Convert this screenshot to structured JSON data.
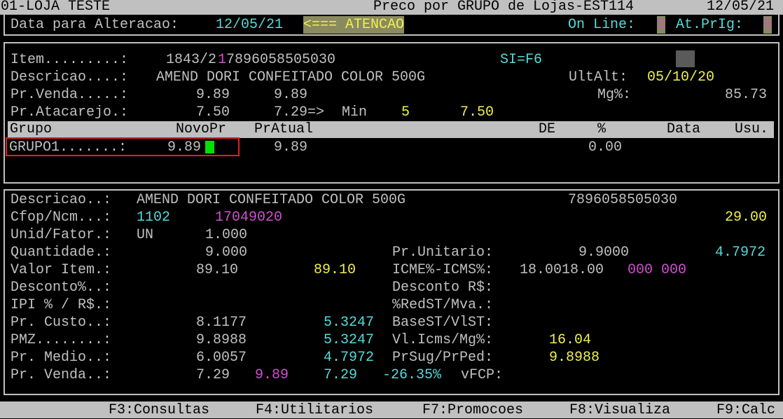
{
  "header": {
    "store": "01-LOJA TESTE",
    "title": "Preco por GRUPO de Lojas-EST114",
    "date": "12/05/21"
  },
  "status": {
    "date_label": "Data para Alteracao:",
    "date_value": "12/05/21",
    "attention": "<=== ATENCAO",
    "online_label": "On Line:",
    "online_value": "S",
    "atprig_label": "At.PrIg:",
    "atprig_value": "S"
  },
  "item": {
    "item_label": "Item.........:",
    "item_code_a": "1843/2",
    "item_code_b": "1",
    "ean": "7896058505030",
    "si": "SI=F6",
    "desc_label": "Descricao....:",
    "desc": "AMEND DORI CONFEITADO COLOR 500G",
    "ultalt_label": "UltAlt:",
    "ultalt": "05/10/20",
    "prvenda_label": "Pr.Venda.....:",
    "prvenda1": "9.89",
    "prvenda2": "9.89",
    "mg_label": "Mg%:",
    "mg": "85.73",
    "atac_label": "Pr.Atacarejo.:",
    "atac1": "7.50",
    "atac2": "7.29=>",
    "min_label": "Min",
    "min_qty": "5",
    "min_price": "7.50"
  },
  "grid": {
    "headers": {
      "grupo": "Grupo",
      "novopr": "NovoPr",
      "pratual": "PrAtual",
      "de": "DE",
      "pct": "%",
      "data": "Data",
      "usu": "Usu."
    },
    "row": {
      "grupo": "GRUPO1.......:",
      "novopr": "9.89",
      "pratual": "9.89",
      "pct": "0.00"
    }
  },
  "detail": {
    "desc_label": "Descricao..:",
    "desc": "AMEND DORI CONFEITADO COLOR 500G",
    "ean": "7896058505030",
    "cfop_label": "Cfop/Ncm...:",
    "cfop": "1102",
    "ncm": "17049020",
    "cfop_right": "29.00",
    "unid_label": "Unid/Fator.:",
    "unid": "UN",
    "fator": "1.000",
    "qtd_label": "Quantidade.:",
    "qtd": "9.000",
    "prunit_label": "Pr.Unitario:",
    "prunit": "9.9000",
    "prunit2": "4.7972",
    "valor_label": "Valor Item.:",
    "valor1": "89.10",
    "valor2": "89.10",
    "icms_label": "ICME%-ICMS%:",
    "icms": "18.0018.00",
    "icms_mg": "000 000",
    "desc_pct_label": "Desconto%..:",
    "desc_rs_label": "Desconto R$:",
    "ipi_label": "IPI % / R$.:",
    "redst_label": "%RedST/Mva.:",
    "custo_label": "Pr. Custo..:",
    "custo1": "8.1177",
    "custo2": "5.3247",
    "basest_label": "BaseST/VlST:",
    "pmz_label": "PMZ........:",
    "pmz1": "9.8988",
    "pmz2": "5.3247",
    "vlicms_label": "Vl.Icms/Mg%:",
    "vlicms": "16.04",
    "medio_label": "Pr. Medio..:",
    "medio1": "6.0057",
    "medio2": "4.7972",
    "prsug_label": "PrSug/PrPed:",
    "prsug": "9.8988",
    "venda_label": "Pr. Venda..:",
    "venda1": "7.29",
    "venda2": "9.89",
    "venda3": "7.29",
    "venda_pct": "-26.35%",
    "vfcp_label": "vFCP:"
  },
  "footer": {
    "f3": "F3:Consultas",
    "f4": "F4:Utilitarios",
    "f7": "F7:Promocoes",
    "f8": "F8:Visualiza",
    "f9": "F9:Calc"
  }
}
